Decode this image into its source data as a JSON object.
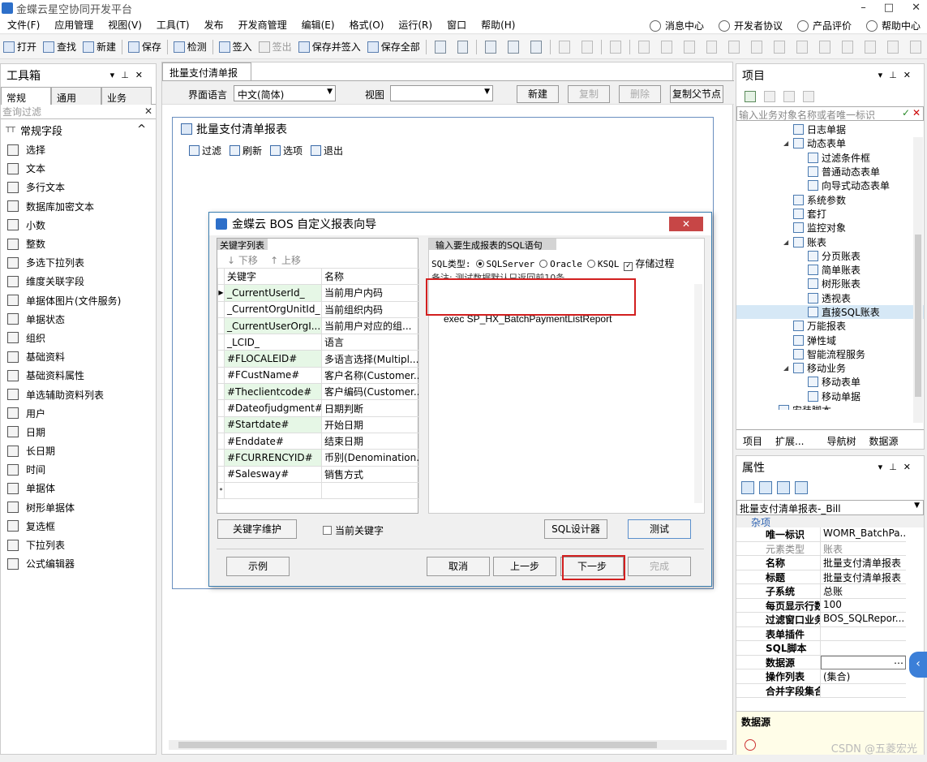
{
  "window": {
    "title": "金蝶云星空协同开发平台",
    "controls": [
      "–",
      "□",
      "✕"
    ]
  },
  "menu": {
    "items": [
      "文件(F)",
      "应用管理",
      "视图(V)",
      "工具(T)",
      "发布",
      "开发商管理",
      "编辑(E)",
      "格式(O)",
      "运行(R)",
      "窗口",
      "帮助(H)"
    ],
    "right": [
      "消息中心",
      "开发者协议",
      "产品评价",
      "帮助中心"
    ]
  },
  "toolbar": {
    "open": "打开",
    "find": "查找",
    "new": "新建",
    "save": "保存",
    "check": "检测",
    "checkin": "签入",
    "checkout": "签出",
    "save_checkin": "保存并签入",
    "save_all": "保存全部"
  },
  "toolbox": {
    "title": "工具箱",
    "tabs": [
      "常规",
      "通用",
      "业务"
    ],
    "filter_placeholder": "查询过滤",
    "group": "常规字段",
    "items": [
      "选择",
      "文本",
      "多行文本",
      "数据库加密文本",
      "小数",
      "整数",
      "多选下拉列表",
      "维度关联字段",
      "单据体图片(文件服务)",
      "单据状态",
      "组织",
      "基础资料",
      "基础资料属性",
      "单选辅助资料列表",
      "用户",
      "日期",
      "长日期",
      "时间",
      "单据体",
      "树形单据体",
      "复选框",
      "下拉列表",
      "公式编辑器"
    ]
  },
  "document": {
    "tab": "批量支付清单报表",
    "lang_label": "界面语言",
    "lang_value": "中文(简体)",
    "view_label": "视图",
    "view_value": "",
    "btn_new": "新建",
    "btn_copy": "复制",
    "btn_delete": "删除",
    "btn_copy_parent": "复制父节点",
    "design_title": "批量支付清单报表",
    "design_tools": [
      "过滤",
      "刷新",
      "选项",
      "退出"
    ]
  },
  "dialog": {
    "title": "金蝶云 BOS 自定义报表向导",
    "close": "✕",
    "kw_tab": "关键字列表",
    "move_down": "下移",
    "move_up": "上移",
    "col_keyword": "关键字",
    "col_name": "名称",
    "rows": [
      {
        "k": "_CurrentUserId_",
        "n": "当前用户内码"
      },
      {
        "k": "_CurrentOrgUnitId_",
        "n": "当前组织内码"
      },
      {
        "k": "_CurrentUserOrgI...",
        "n": "当前用户对应的组..."
      },
      {
        "k": "_LCID_",
        "n": "语言"
      },
      {
        "k": "#FLOCALEID#",
        "n": "多语言选择(Multipl..."
      },
      {
        "k": "#FCustName#",
        "n": "客户名称(Customer..."
      },
      {
        "k": "#Theclientcode#",
        "n": "客户编码(Customer..."
      },
      {
        "k": "#Dateofjudgment#",
        "n": "日期判断"
      },
      {
        "k": "#Startdate#",
        "n": "开始日期"
      },
      {
        "k": "#Enddate#",
        "n": "结束日期"
      },
      {
        "k": "#FCURRENCYID#",
        "n": "币别(Denomination..."
      },
      {
        "k": "#Salesway#",
        "n": "销售方式"
      }
    ],
    "new_row_marker": "*",
    "sql_tab": "输入要生成报表的SQL语句",
    "sql_type_label": "SQL类型:",
    "opt_sqlserver": "SQLServer",
    "opt_oracle": "Oracle",
    "opt_ksql": "KSQL",
    "opt_proc": "存储过程",
    "note": "备注: 测试数据默认只返回前10条",
    "sql_text": "exec SP_HX_BatchPaymentListReport",
    "btn_kw_maint": "关键字维护",
    "chk_current_kw": "当前关键字",
    "btn_sql_designer": "SQL设计器",
    "btn_test": "测试",
    "btn_example": "示例",
    "btn_cancel": "取消",
    "btn_prev": "上一步",
    "btn_next": "下一步",
    "btn_finish": "完成",
    "highlight_color": "#d21f1f"
  },
  "project": {
    "title": "项目",
    "search_placeholder": "输入业务对象名称或者唯一标识",
    "tree": [
      {
        "label": "日志单据",
        "indent": 4
      },
      {
        "label": "动态表单",
        "indent": 4,
        "expanded": true
      },
      {
        "label": "过滤条件框",
        "indent": 5
      },
      {
        "label": "普通动态表单",
        "indent": 5
      },
      {
        "label": "向导式动态表单",
        "indent": 5
      },
      {
        "label": "系统参数",
        "indent": 4
      },
      {
        "label": "套打",
        "indent": 4
      },
      {
        "label": "监控对象",
        "indent": 4
      },
      {
        "label": "账表",
        "indent": 4,
        "expanded": true
      },
      {
        "label": "分页账表",
        "indent": 5
      },
      {
        "label": "简单账表",
        "indent": 5
      },
      {
        "label": "树形账表",
        "indent": 5
      },
      {
        "label": "透视表",
        "indent": 5
      },
      {
        "label": "直接SQL账表",
        "indent": 5,
        "selected": true
      },
      {
        "label": "万能报表",
        "indent": 4
      },
      {
        "label": "弹性域",
        "indent": 4
      },
      {
        "label": "智能流程服务",
        "indent": 4
      },
      {
        "label": "移动业务",
        "indent": 4,
        "expanded": true
      },
      {
        "label": "移动表单",
        "indent": 5
      },
      {
        "label": "移动单据",
        "indent": 5
      },
      {
        "label": "安装脚本",
        "indent": 3
      }
    ],
    "tabs": [
      "项目",
      "扩展...",
      "导航树",
      "数据源"
    ]
  },
  "properties": {
    "title": "属性",
    "object": "批量支付清单报表-_Bill",
    "category": "杂项",
    "rows": [
      {
        "k": "唯一标识",
        "v": "WOMR_BatchPa...",
        "ro": false
      },
      {
        "k": "元素类型",
        "v": "账表",
        "ro": true
      },
      {
        "k": "名称",
        "v": "批量支付清单报表",
        "ro": false
      },
      {
        "k": "标题",
        "v": "批量支付清单报表",
        "ro": false
      },
      {
        "k": "子系统",
        "v": "总账",
        "ro": false
      },
      {
        "k": "每页显示行数",
        "v": "100",
        "ro": false
      },
      {
        "k": "过滤窗口业务",
        "v": "BOS_SQLRepor...",
        "ro": false
      },
      {
        "k": "表单插件",
        "v": "",
        "ro": false
      },
      {
        "k": "SQL脚本",
        "v": "",
        "ro": false
      },
      {
        "k": "数据源",
        "v": "",
        "ro": false,
        "selected": true
      },
      {
        "k": "操作列表",
        "v": "(集合)",
        "ro": false
      },
      {
        "k": "合并字段集合",
        "v": "",
        "ro": false
      }
    ],
    "desc_title": "数据源"
  },
  "watermark": "CSDN @五菱宏光"
}
